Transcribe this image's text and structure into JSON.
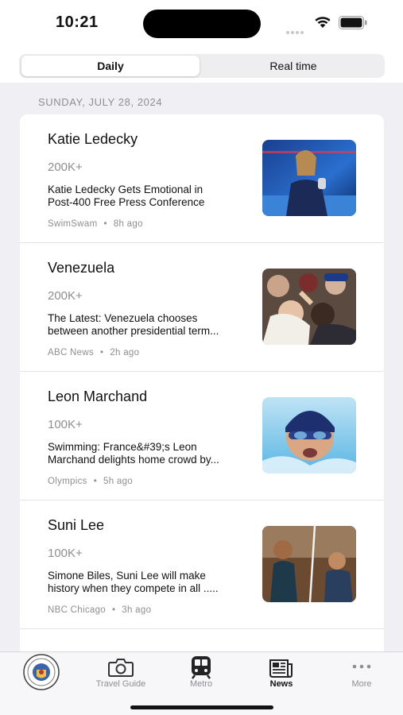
{
  "status_bar": {
    "time": "10:21"
  },
  "segmented": {
    "daily": "Daily",
    "realtime": "Real time"
  },
  "date_header": "SUNDAY, JULY 28, 2024",
  "trends": [
    {
      "title": "Katie Ledecky",
      "count": "200K+",
      "headline_line1": "Katie Ledecky Gets Emotional in",
      "headline_line2": "Post-400 Free Press Conference",
      "source": "SwimSwam",
      "time": "8h ago"
    },
    {
      "title": "Venezuela",
      "count": "200K+",
      "headline_line1": "The Latest: Venezuela chooses",
      "headline_line2": "between another presidential term...",
      "source": "ABC News",
      "time": "2h ago"
    },
    {
      "title": "Leon Marchand",
      "count": "100K+",
      "headline_line1": "Swimming: France&#39;s Leon",
      "headline_line2": "Marchand delights home crowd by...",
      "source": "Olympics",
      "time": "5h ago"
    },
    {
      "title": "Suni Lee",
      "count": "100K+",
      "headline_line1": "Simone Biles, Suni Lee will make",
      "headline_line2": "history when they compete in all .....",
      "source": "NBC Chicago",
      "time": "3h ago"
    }
  ],
  "tabbar": {
    "travel_guide": "Travel Guide",
    "metro": "Metro",
    "news": "News",
    "more": "More",
    "active": "News"
  },
  "icons": {
    "seal": "city-seal-icon",
    "travel_guide": "camera-icon",
    "metro": "train-icon",
    "news": "newspaper-icon",
    "more": "ellipsis-icon"
  }
}
